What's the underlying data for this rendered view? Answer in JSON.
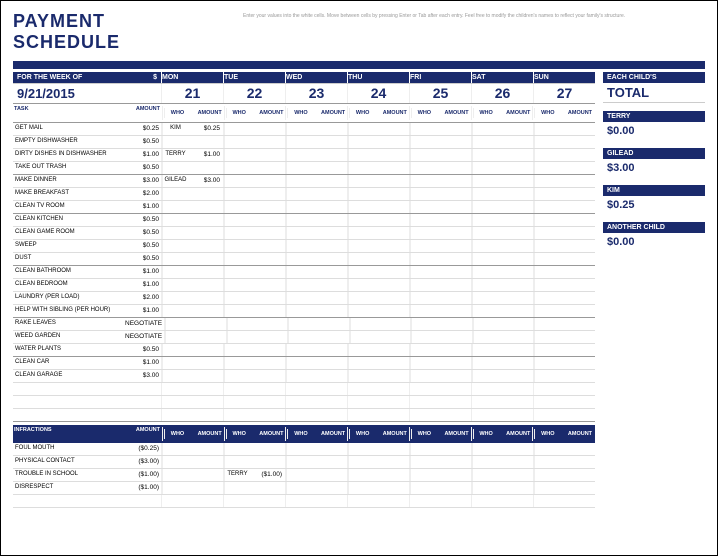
{
  "title": "PAYMENT SCHEDULE",
  "note": "Enter your values into the white cells. Move between cells by pressing Enter or Tab after each entry. Feel free to modify the children's names to reflect your family's structure.",
  "weekLabel": "FOR THE WEEK OF",
  "dollar": "$",
  "date": "9/21/2015",
  "days": [
    {
      "n": "MON",
      "d": "21"
    },
    {
      "n": "TUE",
      "d": "22"
    },
    {
      "n": "WED",
      "d": "23"
    },
    {
      "n": "THU",
      "d": "24"
    },
    {
      "n": "FRI",
      "d": "25"
    },
    {
      "n": "SAT",
      "d": "26"
    },
    {
      "n": "SUN",
      "d": "27"
    }
  ],
  "hTask": "TASK",
  "hAmt": "AMOUNT",
  "hWho": "WHO",
  "tasks": [
    {
      "t": "GET MAIL",
      "a": "$0.25",
      "e": [
        {
          "w": "KIM",
          "v": "$0.25"
        }
      ],
      "sep": false
    },
    {
      "t": "EMPTY DISHWASHER",
      "a": "$0.50",
      "e": [],
      "sep": false
    },
    {
      "t": "DIRTY DISHES IN DISHWASHER",
      "a": "$1.00",
      "e": [
        {
          "w": "TERRY",
          "v": "$1.00"
        }
      ],
      "sep": false
    },
    {
      "t": "TAKE OUT TRASH",
      "a": "$0.50",
      "e": [],
      "sep": true
    },
    {
      "t": "MAKE DINNER",
      "a": "$3.00",
      "e": [
        {
          "w": "GILEAD",
          "v": "$3.00"
        }
      ],
      "sep": false
    },
    {
      "t": "MAKE BREAKFAST",
      "a": "$2.00",
      "e": [],
      "sep": false
    },
    {
      "t": "CLEAN TV ROOM",
      "a": "$1.00",
      "e": [],
      "sep": true
    },
    {
      "t": "CLEAN KITCHEN",
      "a": "$0.50",
      "e": [],
      "sep": false
    },
    {
      "t": "CLEAN GAME ROOM",
      "a": "$0.50",
      "e": [],
      "sep": false
    },
    {
      "t": "SWEEP",
      "a": "$0.50",
      "e": [],
      "sep": false
    },
    {
      "t": "DUST",
      "a": "$0.50",
      "e": [],
      "sep": true
    },
    {
      "t": "CLEAN BATHROOM",
      "a": "$1.00",
      "e": [],
      "sep": false
    },
    {
      "t": "CLEAN BEDROOM",
      "a": "$1.00",
      "e": [],
      "sep": false
    },
    {
      "t": "LAUNDRY (PER LOAD)",
      "a": "$2.00",
      "e": [],
      "sep": false
    },
    {
      "t": "HELP WITH SIBLING (PER HOUR)",
      "a": "$1.00",
      "e": [],
      "sep": true
    },
    {
      "t": "RAKE LEAVES",
      "a": "NEGOTIATE",
      "e": [],
      "sep": false
    },
    {
      "t": "WEED GARDEN",
      "a": "NEGOTIATE",
      "e": [],
      "sep": false
    },
    {
      "t": "WATER PLANTS",
      "a": "$0.50",
      "e": [],
      "sep": true
    },
    {
      "t": "CLEAN CAR",
      "a": "$1.00",
      "e": [],
      "sep": false
    },
    {
      "t": "CLEAN GARAGE",
      "a": "$3.00",
      "e": [],
      "sep": false
    }
  ],
  "infrHead": "INFRACTIONS",
  "infractions": [
    {
      "t": "FOUL MOUTH",
      "a": "($0.25)",
      "e": []
    },
    {
      "t": "PHYSICAL CONTACT",
      "a": "($3.00)",
      "e": []
    },
    {
      "t": "TROUBLE IN SCHOOL",
      "a": "($1.00)",
      "e": [
        {
          "d": 1,
          "w": "TERRY",
          "v": "($1.00)"
        }
      ]
    },
    {
      "t": "DISRESPECT",
      "a": "($1.00)",
      "e": []
    }
  ],
  "sideHead": "EACH CHILD'S",
  "sideTotal": "TOTAL",
  "children": [
    {
      "n": "TERRY",
      "v": "$0.00"
    },
    {
      "n": "GILEAD",
      "v": "$3.00"
    },
    {
      "n": "KIM",
      "v": "$0.25"
    },
    {
      "n": "ANOTHER CHILD",
      "v": "$0.00"
    }
  ]
}
